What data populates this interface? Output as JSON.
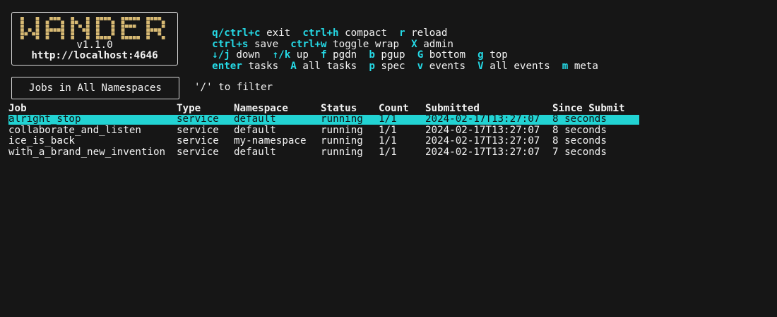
{
  "app": {
    "logo_text": "WANDER",
    "version": "v1.1.0",
    "host": "http://localhost:4646"
  },
  "keybindings": [
    [
      {
        "key": "q/ctrl+c",
        "desc": "exit"
      },
      {
        "key": "ctrl+h",
        "desc": "compact"
      },
      {
        "key": "r",
        "desc": "reload"
      }
    ],
    [
      {
        "key": "ctrl+s",
        "desc": "save"
      },
      {
        "key": "ctrl+w",
        "desc": "toggle wrap"
      },
      {
        "key": "X",
        "desc": "admin"
      }
    ],
    [
      {
        "key": "↓/j",
        "desc": "down"
      },
      {
        "key": "↑/k",
        "desc": "up"
      },
      {
        "key": "f",
        "desc": "pgdn"
      },
      {
        "key": "b",
        "desc": "pgup"
      },
      {
        "key": "G",
        "desc": "bottom"
      },
      {
        "key": "g",
        "desc": "top"
      }
    ],
    [
      {
        "key": "enter",
        "desc": "tasks"
      },
      {
        "key": "A",
        "desc": "all tasks"
      },
      {
        "key": "p",
        "desc": "spec"
      },
      {
        "key": "v",
        "desc": "events"
      },
      {
        "key": "V",
        "desc": "all events"
      },
      {
        "key": "m",
        "desc": "meta"
      }
    ]
  ],
  "view": {
    "title": "Jobs in All Namespaces",
    "filter_hint": "'/' to filter"
  },
  "table": {
    "columns": [
      "Job",
      "Type",
      "Namespace",
      "Status",
      "Count",
      "Submitted",
      "Since Submit"
    ],
    "rows": [
      [
        "alright_stop",
        "service",
        "default",
        "running",
        "1/1",
        "2024-02-17T13:27:07",
        "8 seconds"
      ],
      [
        "collaborate_and_listen",
        "service",
        "default",
        "running",
        "1/1",
        "2024-02-17T13:27:07",
        "8 seconds"
      ],
      [
        "ice_is_back",
        "service",
        "my-namespace",
        "running",
        "1/1",
        "2024-02-17T13:27:07",
        "8 seconds"
      ],
      [
        "with_a_brand_new_invention",
        "service",
        "default",
        "running",
        "1/1",
        "2024-02-17T13:27:07",
        "7 seconds"
      ]
    ],
    "selected_row": 0
  },
  "colors": {
    "key_accent": "#25d9e5",
    "logo_gold": "#d8ba74",
    "selection": "#22d3d3",
    "background": "#161616"
  }
}
